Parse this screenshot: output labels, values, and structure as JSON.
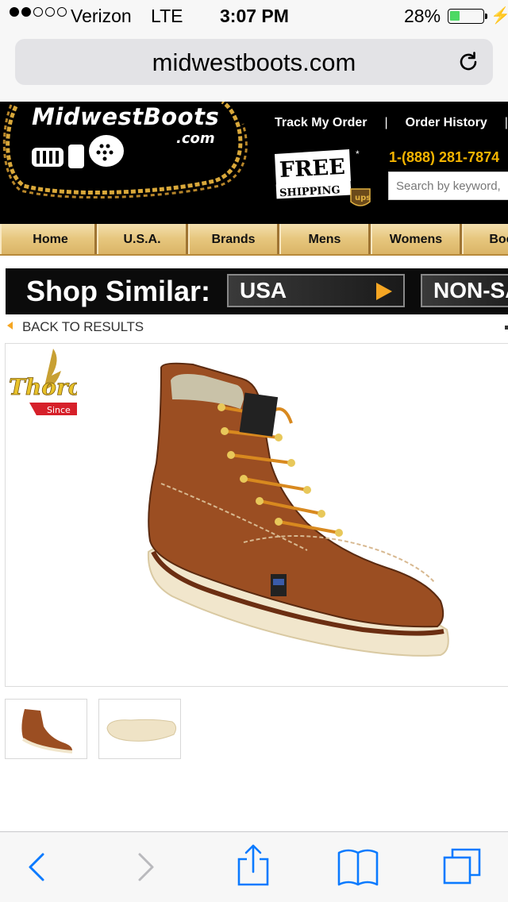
{
  "status": {
    "carrier": "Verizon",
    "network": "LTE",
    "time": "3:07 PM",
    "battery": "28%",
    "signal_bars": 2,
    "battery_level": 0.28
  },
  "browser": {
    "url": "midwestboots.com"
  },
  "header": {
    "logo": "MidwestBoots",
    "logo_suffix": ".com",
    "links": [
      "Track My Order",
      "Order History"
    ],
    "free_shipping": "FREE SHIPPING",
    "phone": "1-(888) 281-7874",
    "search_placeholder": "Search by keyword,"
  },
  "nav": [
    "Home",
    "U.S.A.",
    "Brands",
    "Mens",
    "Womens",
    "Boots"
  ],
  "shop_similar": {
    "label": "Shop Similar:",
    "options": [
      "USA",
      "NON-SAFETY"
    ]
  },
  "back_link": "BACK TO RESULTS",
  "product": {
    "brand": "Thorogood",
    "brand_tagline": "Since"
  },
  "colors": {
    "nav_gold": "#e4c581",
    "accent_orange": "#f5a623",
    "ios_blue": "#0a7aff",
    "phone_gold": "#f4b400"
  },
  "toolbar": [
    "back-icon",
    "forward-icon",
    "share-icon",
    "bookmarks-icon",
    "tabs-icon"
  ]
}
